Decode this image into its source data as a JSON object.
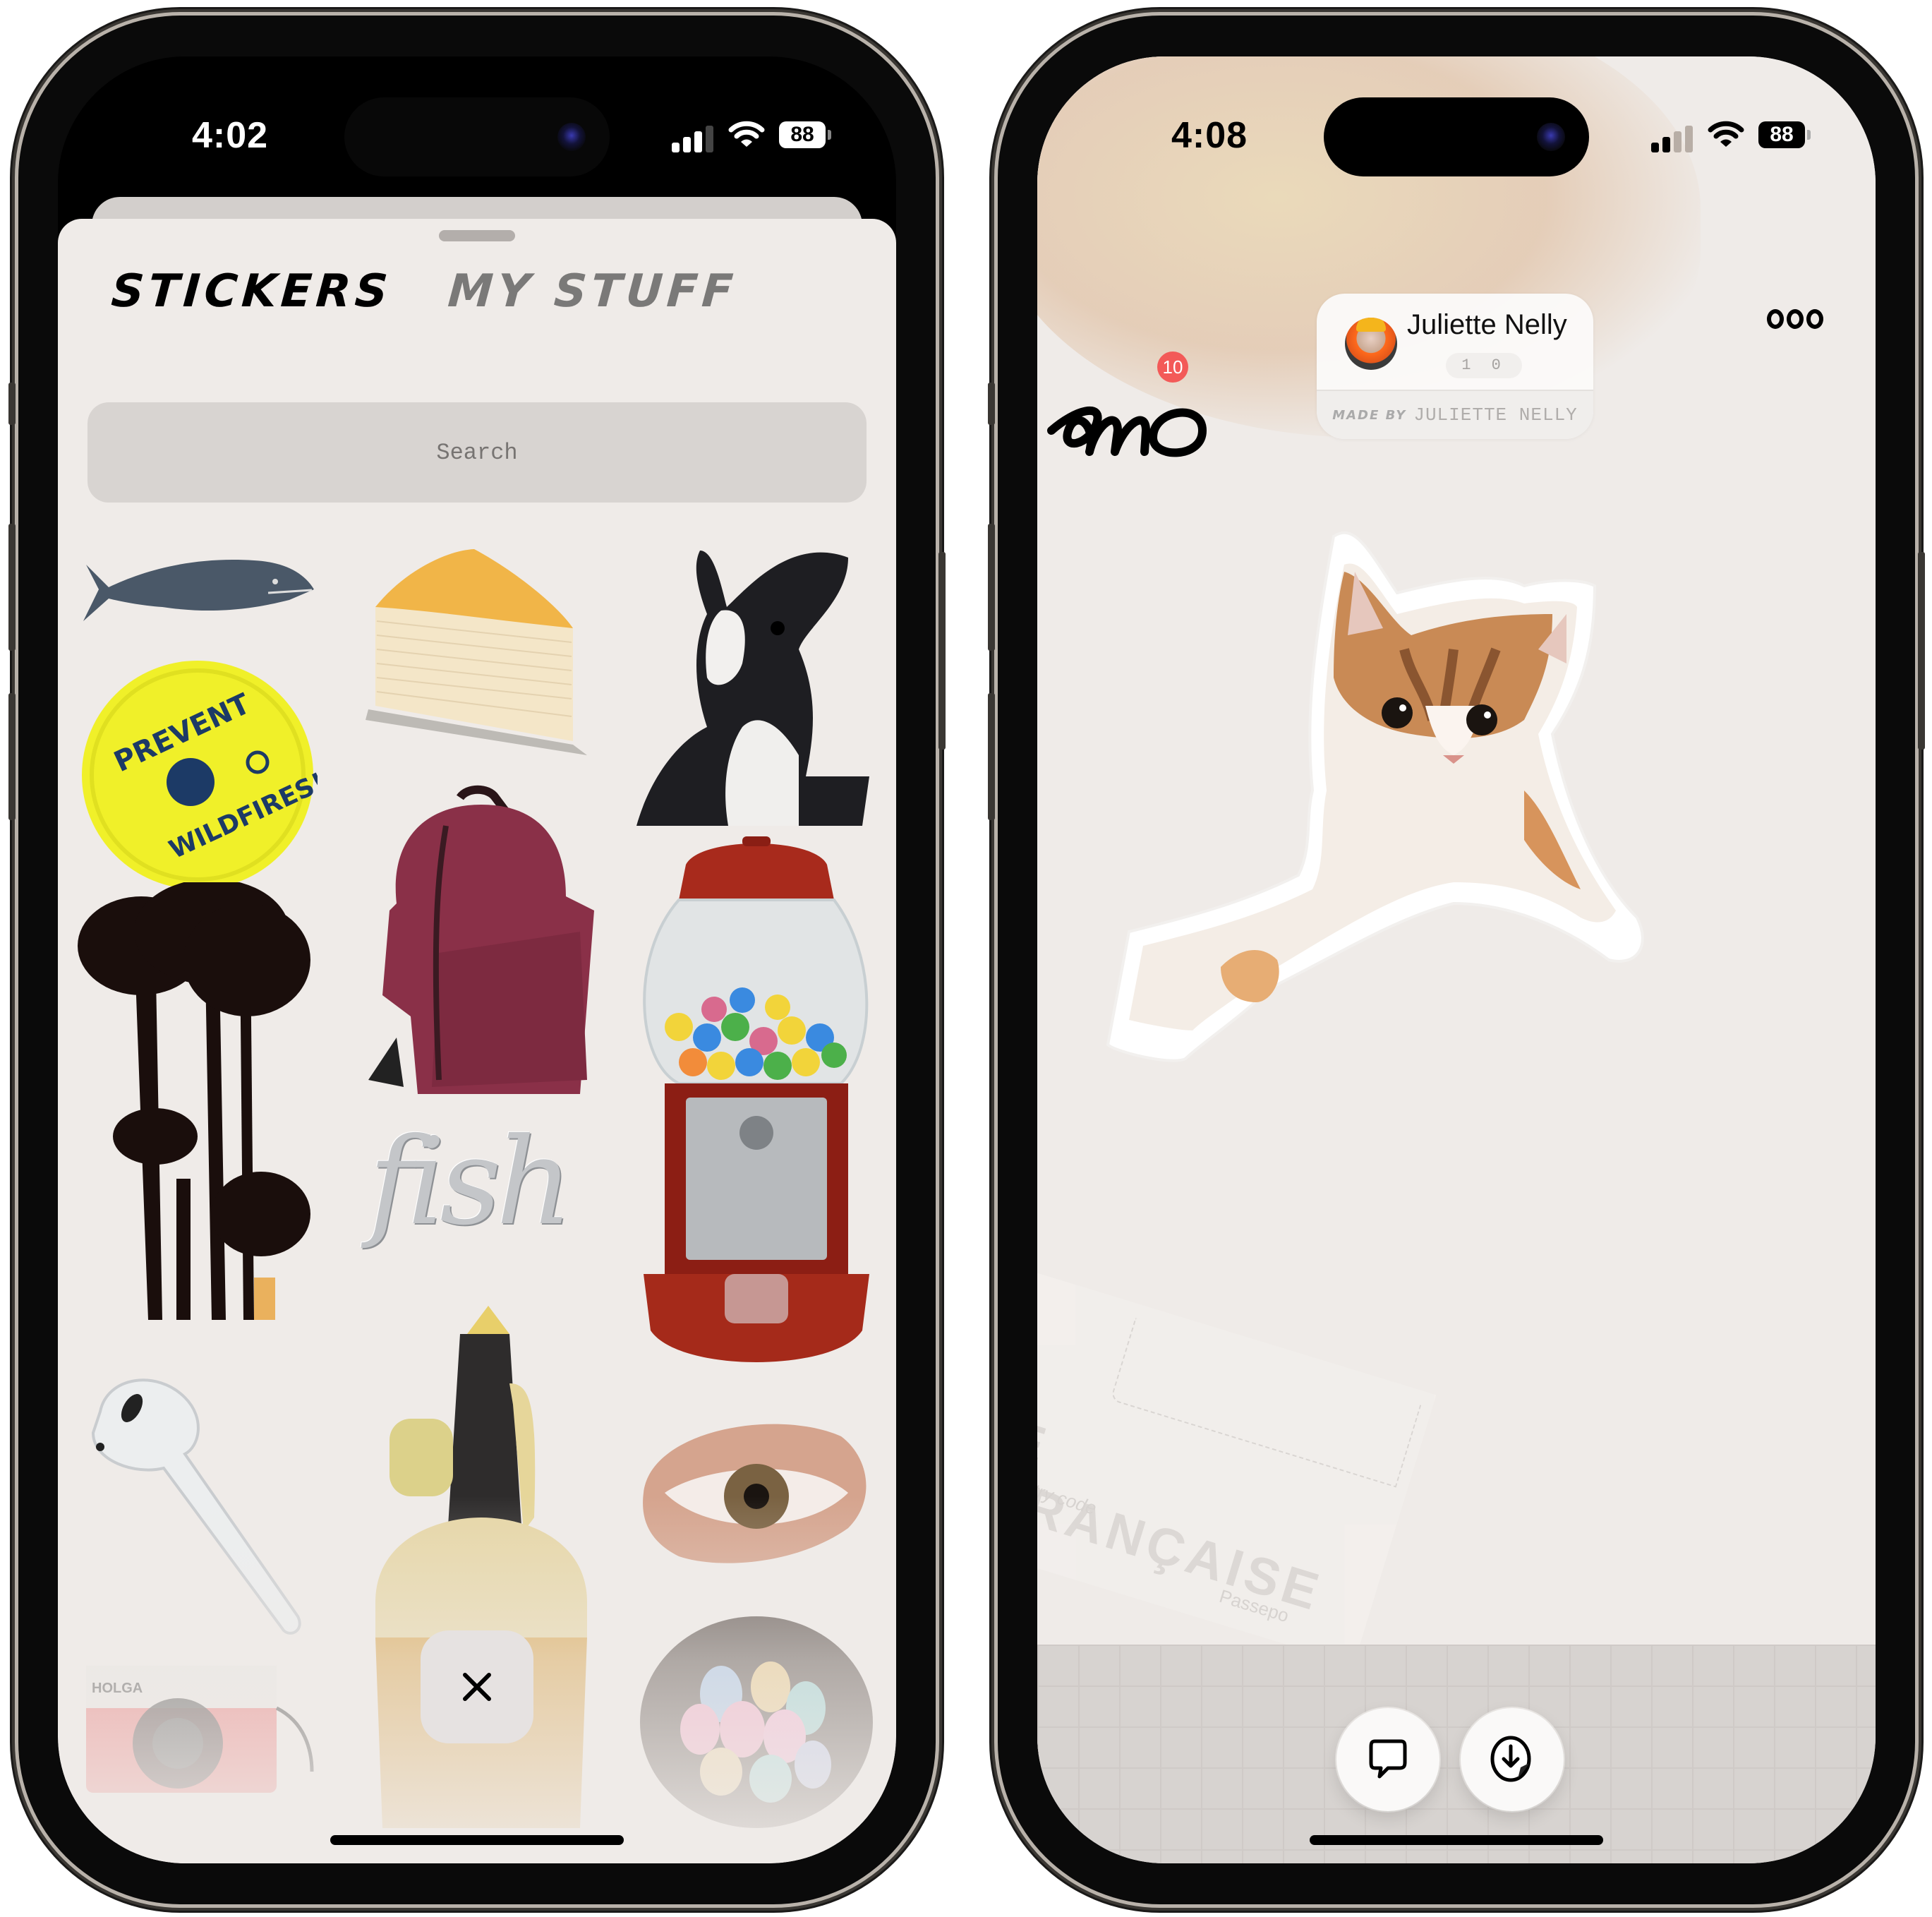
{
  "left_screen": {
    "status_bar": {
      "time": "4:02",
      "battery": "88",
      "signal_bars": 3,
      "signal_max": 4
    },
    "tabs": [
      {
        "label": "STICKERS",
        "active": true
      },
      {
        "label": "MY STUFF",
        "active": false
      }
    ],
    "search": {
      "placeholder": "Search",
      "value": ""
    },
    "stickers": [
      {
        "name": "whale"
      },
      {
        "name": "crepe-cake-slice"
      },
      {
        "name": "black-white-rabbit"
      },
      {
        "name": "prevent-wildfires-frisbee",
        "text": [
          "PREVENT",
          "WILDFIRES!"
        ]
      },
      {
        "name": "maroon-backpack"
      },
      {
        "name": "gumball-machine"
      },
      {
        "name": "palm-trees-silhouette"
      },
      {
        "name": "fish-chrome-text",
        "text": "fish"
      },
      {
        "name": "airpod"
      },
      {
        "name": "soda-siphon"
      },
      {
        "name": "eye"
      },
      {
        "name": "holga-camera",
        "text": "HOLGA"
      },
      {
        "name": "egg-nest"
      }
    ],
    "close_label": "×"
  },
  "right_screen": {
    "status_bar": {
      "time": "4:08",
      "battery": "88",
      "signal_bars": 2,
      "signal_max": 4
    },
    "app_logo": "amo",
    "notification_count": "10",
    "creator": {
      "name": "Juliette Nelly",
      "count": "1 0",
      "made_by_label": "MADE BY",
      "made_by_name": "JULIETTE NELLY"
    },
    "sticker": {
      "name": "kitten"
    },
    "background_text": {
      "title": "E FRANÇAISE",
      "country_code": "/Country code",
      "passport": "Passepo"
    },
    "actions": [
      {
        "name": "comment",
        "icon": "speech-bubble-icon"
      },
      {
        "name": "save-sticker",
        "icon": "download-sticker-icon"
      }
    ],
    "colors": {
      "notification": "#f35a58",
      "canvas": "#efebe8",
      "sheet": "#efebe8",
      "search_bg": "#d8d4d1"
    }
  }
}
